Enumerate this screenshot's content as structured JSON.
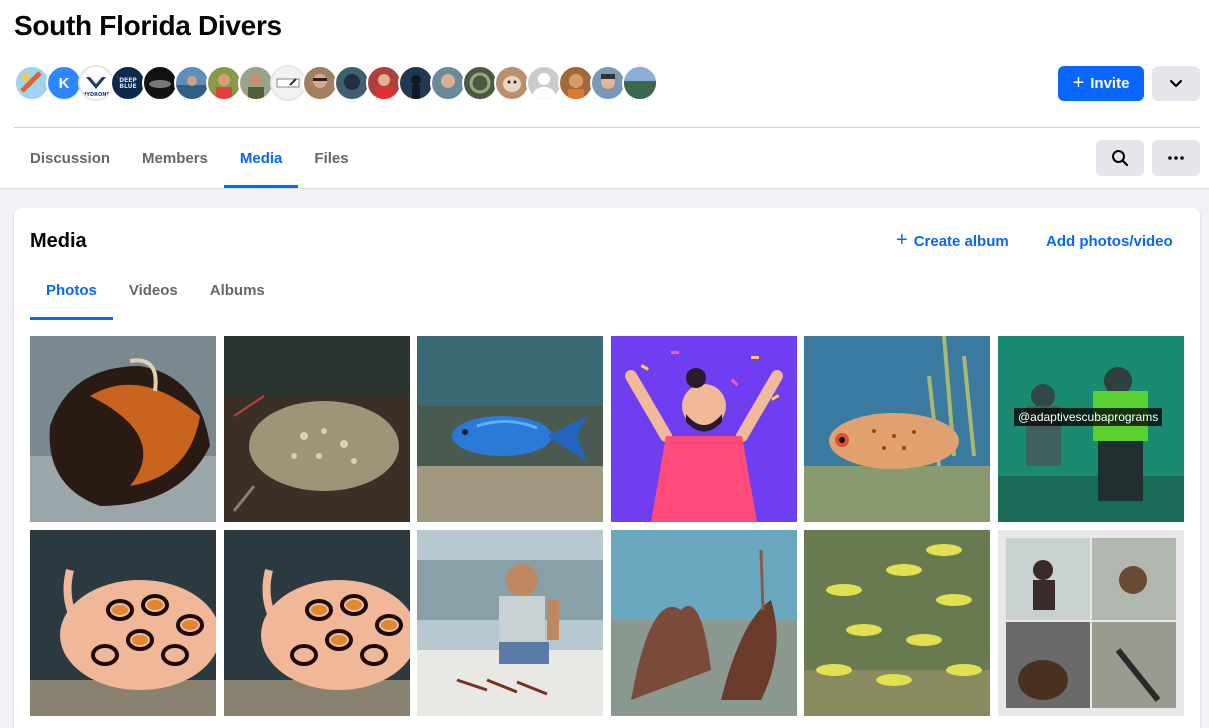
{
  "group": {
    "name": "South Florida Divers"
  },
  "members_preview": [
    {
      "name": "member-1",
      "color": "#f4b860",
      "initial": ""
    },
    {
      "name": "member-2",
      "color": "#2d88ff",
      "initial": "K"
    },
    {
      "name": "member-3",
      "color": "#ffffff",
      "initial": ""
    },
    {
      "name": "member-4",
      "color": "#0d2a4a",
      "initial": ""
    },
    {
      "name": "member-5",
      "color": "#111111",
      "initial": ""
    },
    {
      "name": "member-6",
      "color": "#5d8fb8",
      "initial": ""
    },
    {
      "name": "member-7",
      "color": "#8a9a4a",
      "initial": ""
    },
    {
      "name": "member-8",
      "color": "#9aa48a",
      "initial": ""
    },
    {
      "name": "member-9",
      "color": "#f2f2f2",
      "initial": ""
    },
    {
      "name": "member-10",
      "color": "#a08060",
      "initial": ""
    },
    {
      "name": "member-11",
      "color": "#406070",
      "initial": ""
    },
    {
      "name": "member-12",
      "color": "#b04040",
      "initial": ""
    },
    {
      "name": "member-13",
      "color": "#203850",
      "initial": ""
    },
    {
      "name": "member-14",
      "color": "#6a8a9a",
      "initial": ""
    },
    {
      "name": "member-15",
      "color": "#4a5a40",
      "initial": ""
    },
    {
      "name": "member-16",
      "color": "#b89070",
      "initial": ""
    },
    {
      "name": "member-17",
      "color": "#c8ccd2",
      "initial": ""
    },
    {
      "name": "member-18",
      "color": "#a06a3a",
      "initial": ""
    },
    {
      "name": "member-19",
      "color": "#7a98b8",
      "initial": ""
    },
    {
      "name": "member-20",
      "color": "#4a7a5a",
      "initial": ""
    }
  ],
  "header_actions": {
    "invite_label": "Invite"
  },
  "nav": {
    "tabs": [
      "Discussion",
      "Members",
      "Media",
      "Files"
    ],
    "active": "Media"
  },
  "media": {
    "title": "Media",
    "create_album_label": "Create album",
    "add_photos_label": "Add photos/video",
    "subtabs": [
      "Photos",
      "Videos",
      "Albums"
    ],
    "active_subtab": "Photos",
    "photos": [
      {
        "subject": "conch shell on sand"
      },
      {
        "subject": "spotted stingray"
      },
      {
        "subject": "blue parrotfish"
      },
      {
        "subject": "celebration illustration"
      },
      {
        "subject": "porcupinefish on reef"
      },
      {
        "subject": "divers in green water",
        "overlay": "@adaptivescubaprograms"
      },
      {
        "subject": "flamingo tongue snail"
      },
      {
        "subject": "flamingo tongue snail"
      },
      {
        "subject": "man on boat with lobsters"
      },
      {
        "subject": "sea fans on reef"
      },
      {
        "subject": "school of yellow grunts"
      },
      {
        "subject": "diver photo collage"
      }
    ]
  },
  "colors": {
    "accent": "#0866ff",
    "page_bg": "#f0f2f5"
  }
}
